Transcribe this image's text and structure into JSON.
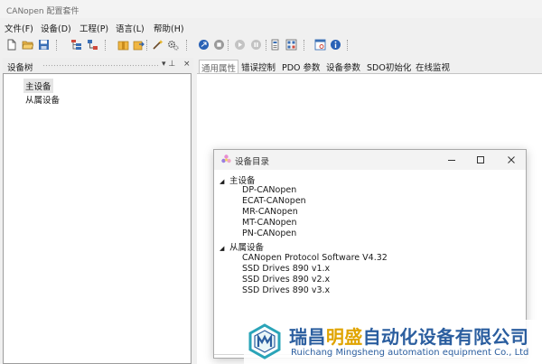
{
  "window": {
    "title": "CANopen 配置套件"
  },
  "menu": [
    "文件(F)",
    "设备(D)",
    "工程(P)",
    "语言(L)",
    "帮助(H)"
  ],
  "toolbar_icons": [
    "new-file-icon",
    "open-folder-icon",
    "save-icon",
    "list-tree-icon",
    "network-icon",
    "package-icon",
    "export-icon",
    "wand-icon",
    "gears-icon",
    "connect-icon",
    "stop-icon",
    "play-icon",
    "pause-icon",
    "device-icon",
    "grid-config-icon",
    "settings-window-icon",
    "info-icon"
  ],
  "device_tree": {
    "title": "设备树",
    "pin": "▾ ⊥",
    "close": "×",
    "nodes": [
      "主设备",
      "从属设备"
    ]
  },
  "tabs": [
    "通用属性",
    "错误控制",
    "PDO 参数",
    "设备参数",
    "SDO初始化",
    "在线监视"
  ],
  "dialog": {
    "title": "设备目录",
    "categories": [
      {
        "label": "主设备",
        "items": [
          "DP-CANopen",
          "ECAT-CANopen",
          "MR-CANopen",
          "MT-CANopen",
          "PN-CANopen"
        ]
      },
      {
        "label": "从属设备",
        "items": [
          "CANopen Protocol Software V4.32",
          "SSD Drives 890 v1.x",
          "SSD Drives 890 v2.x",
          "SSD Drives 890 v3.x"
        ]
      }
    ]
  },
  "watermark": {
    "cn_part1": "瑞昌",
    "cn_part2": "明盛",
    "cn_part3": "自动化设备有限公司",
    "en": "Ruichang Mingsheng automation equipment Co., Ltd"
  },
  "colors": {
    "accent_blue": "#2b5e9f",
    "accent_gold": "#e0a400",
    "teal": "#2aa4b8"
  }
}
